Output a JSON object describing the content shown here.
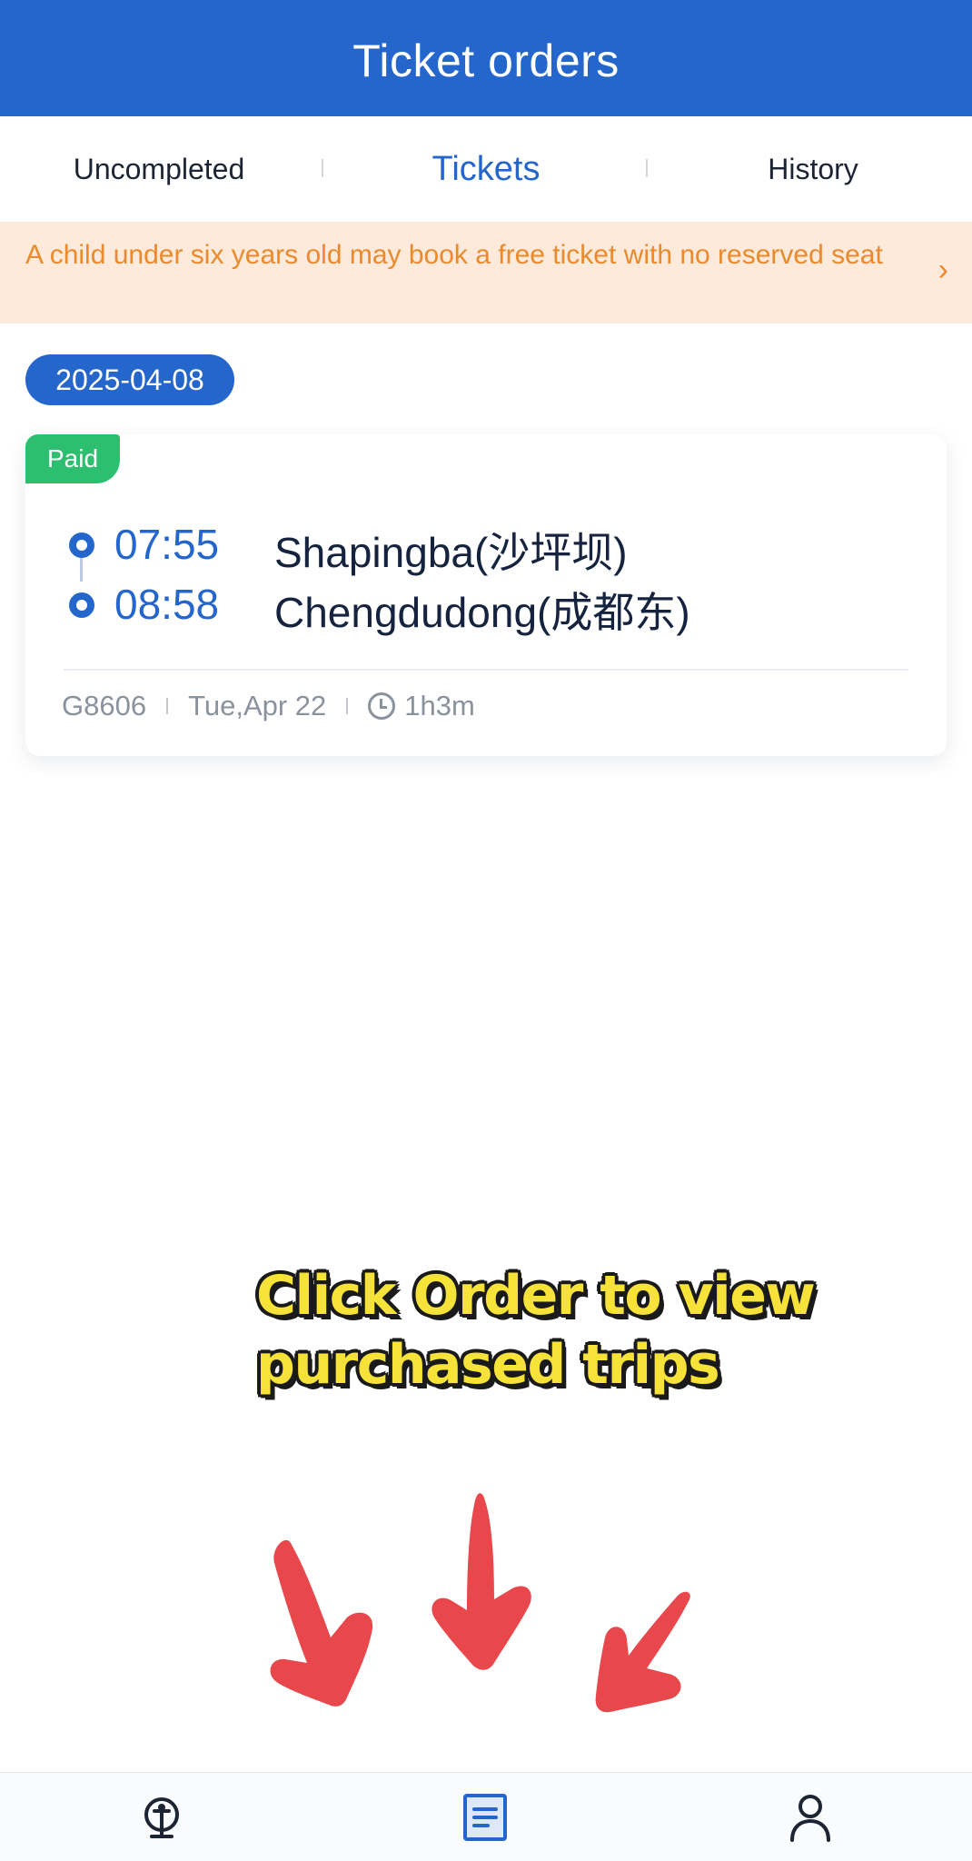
{
  "header": {
    "title": "Ticket orders"
  },
  "tabs": [
    {
      "label": "Uncompleted",
      "active": false
    },
    {
      "label": "Tickets",
      "active": true
    },
    {
      "label": "History",
      "active": false
    }
  ],
  "notice": {
    "text": "A child under six years old may book a free ticket with no reserved seat",
    "chevron": "›"
  },
  "order_group": {
    "date": "2025-04-08",
    "ticket": {
      "status": "Paid",
      "departure": {
        "time": "07:55",
        "station": "Shapingba(沙坪坝)"
      },
      "arrival": {
        "time": "08:58",
        "station": "Chengdudong(成都东)"
      },
      "train": "G8606",
      "date": "Tue,Apr 22",
      "duration": "1h3m"
    }
  },
  "overlay": {
    "caption_line1": "Click Order to view",
    "caption_line2": "purchased trips"
  },
  "bottom_nav": {
    "items": [
      {
        "icon": "train-icon",
        "active": false
      },
      {
        "icon": "orders-icon",
        "active": true
      },
      {
        "icon": "profile-icon",
        "active": false
      }
    ]
  },
  "colors": {
    "primary": "#2466cc",
    "paid": "#2cbf6f",
    "notice_bg": "#fdeadb",
    "notice_text": "#ea8a2c",
    "caption": "#f7e23a",
    "arrow": "#e8474c"
  }
}
